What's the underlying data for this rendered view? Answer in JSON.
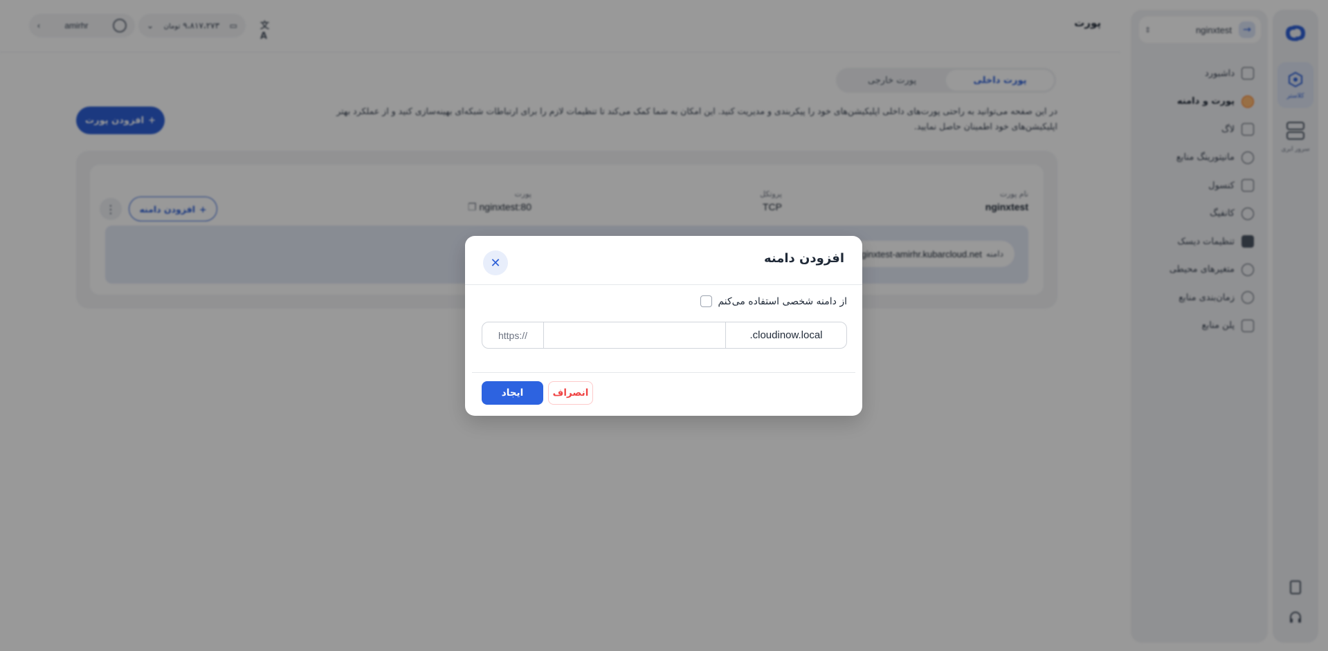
{
  "header": {
    "page_title": "پورت",
    "user_name": "amirhr",
    "credit": "۹،۸۱۷،۲۷۳",
    "credit_unit": "تومان"
  },
  "rail": {
    "items": [
      {
        "label": "کلاستر",
        "icon": "cluster-icon",
        "active": true
      },
      {
        "label": "سرور ابری",
        "icon": "server-icon",
        "active": false
      }
    ]
  },
  "sidebar": {
    "project_name": "nginxtest",
    "items": [
      {
        "label": "داشبورد",
        "icon": "dashboard-icon"
      },
      {
        "label": "پورت و دامنه",
        "icon": "globe-icon",
        "active": true
      },
      {
        "label": "لاگ",
        "icon": "log-icon"
      },
      {
        "label": "مانیتورینگ منابع",
        "icon": "monitoring-icon"
      },
      {
        "label": "کنسول",
        "icon": "console-icon"
      },
      {
        "label": "کانفیگ",
        "icon": "config-icon"
      },
      {
        "label": "تنظیمات دیسک",
        "icon": "disk-icon"
      },
      {
        "label": "متغیرهای محیطی",
        "icon": "env-icon"
      },
      {
        "label": "زمان‌بندی منابع",
        "icon": "clock-icon"
      },
      {
        "label": "پلن منابع",
        "icon": "plan-icon"
      }
    ]
  },
  "main": {
    "tabs": [
      {
        "label": "پورت داخلی",
        "active": true
      },
      {
        "label": "پورت خارجی",
        "active": false
      }
    ],
    "description": "در این صفحه می‌توانید به راحتی پورت‌های داخلی اپلیکیشن‌های خود را پیکربندی و مدیریت کنید. این امکان به شما کمک می‌کند تا تنظیمات لازم را برای ارتباطات شبکه‌ای بهینه‌سازی کنید و از عملکرد بهتر اپلیکیشن‌های خود اطمینان حاصل نمایید.",
    "add_port_label": "افزودن پورت",
    "port_card": {
      "name_label": "نام پورت",
      "name_value": "nginxtest",
      "protocol_label": "پروتکل",
      "protocol_value": "TCP",
      "port_label": "پورت",
      "port_value": "nginxtest:80",
      "add_domain_label": "افزودن دامنه",
      "domain_label": "دامنه",
      "domain_value": "nginxtest-amirhr.kubarcloud.net"
    }
  },
  "modal": {
    "title": "افزودن دامنه",
    "checkbox_label": "از دامنه شخصی استفاده می‌کنم",
    "checkbox_checked": false,
    "url_prefix": "https://",
    "subdomain_value": "",
    "url_suffix": ".cloudinow.local",
    "cancel_label": "انصراف",
    "create_label": "ایجاد"
  },
  "colors": {
    "accent": "#2d5fd6",
    "danger": "#ef4444"
  }
}
